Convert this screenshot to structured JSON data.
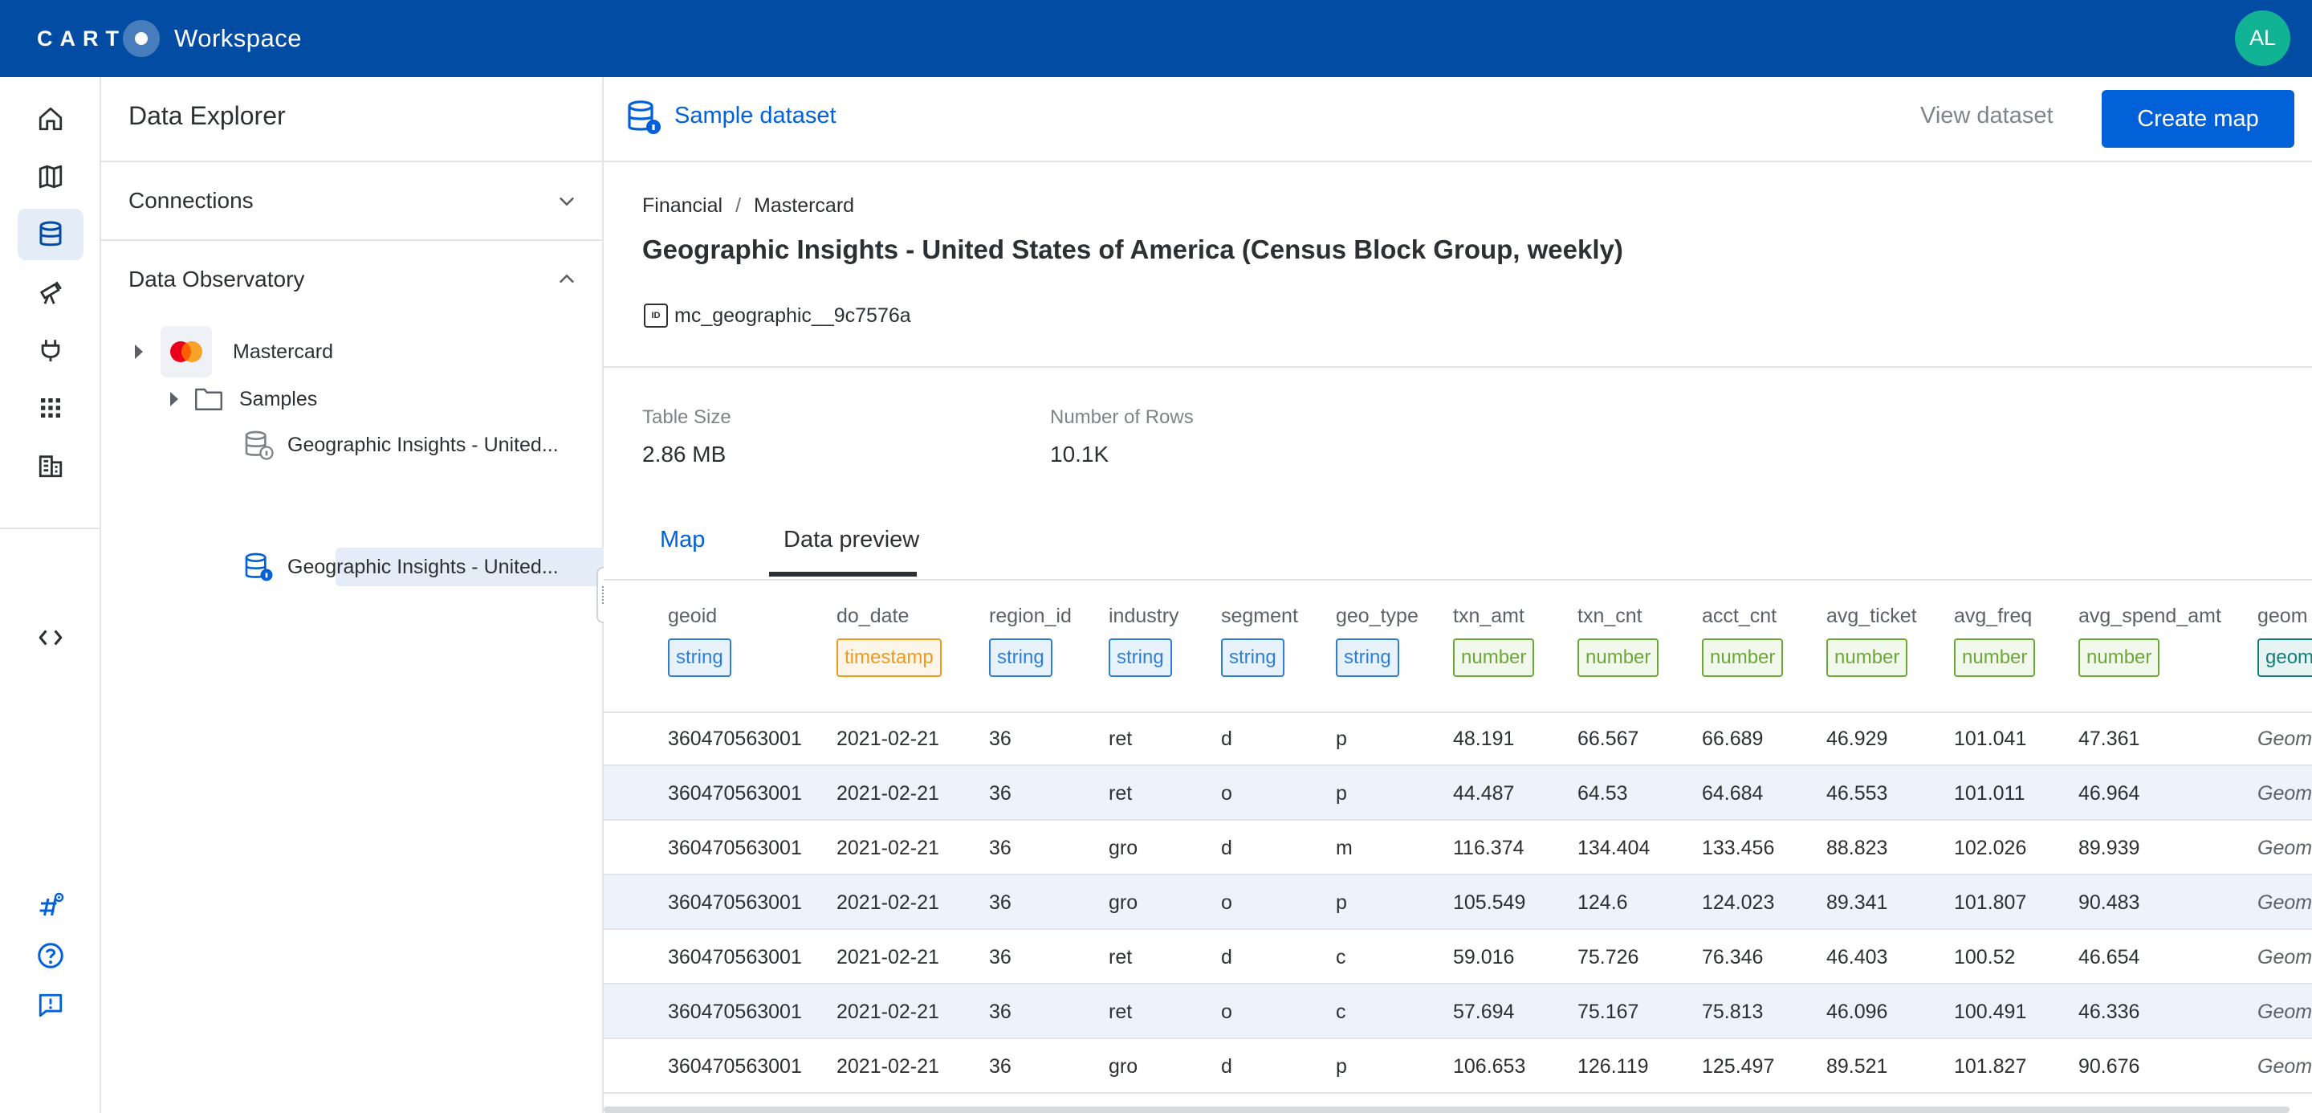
{
  "topbar": {
    "logo_text": "CARTO",
    "product": "Workspace",
    "avatar_initials": "AL"
  },
  "rail": {
    "items": [
      "home-icon",
      "map-icon",
      "database-icon",
      "telescope-icon",
      "plug-icon",
      "apps-grid-icon",
      "building-icon"
    ],
    "active": "database-icon",
    "bottom_items": [
      "developers-code-icon",
      "hashtag-icon",
      "help-icon",
      "feedback-icon"
    ]
  },
  "explorer": {
    "title": "Data Explorer",
    "connections_label": "Connections",
    "observatory_label": "Data Observatory",
    "provider": "Mastercard",
    "folder": "Samples",
    "datasets": [
      "Geographic Insights - United...",
      "Geographic Insights - United..."
    ]
  },
  "header": {
    "dataset_label": "Sample dataset",
    "view_dataset": "View dataset",
    "create_map": "Create map"
  },
  "dataset": {
    "breadcrumb": [
      "Financial",
      "Mastercard"
    ],
    "breadcrumb_sep": "/",
    "title": "Geographic Insights - United States of America (Census Block Group, weekly)",
    "id_badge": "ID",
    "id": "mc_geographic__9c7576a",
    "stats": [
      {
        "label": "Table Size",
        "value": "2.86 MB"
      },
      {
        "label": "Number of Rows",
        "value": "10.1K"
      }
    ]
  },
  "tabs": [
    "Map",
    "Data preview"
  ],
  "active_tab": "Data preview",
  "table": {
    "columns": [
      {
        "name": "geoid",
        "type": "string"
      },
      {
        "name": "do_date",
        "type": "timestamp"
      },
      {
        "name": "region_id",
        "type": "string"
      },
      {
        "name": "industry",
        "type": "string"
      },
      {
        "name": "segment",
        "type": "string"
      },
      {
        "name": "geo_type",
        "type": "string"
      },
      {
        "name": "txn_amt",
        "type": "number"
      },
      {
        "name": "txn_cnt",
        "type": "number"
      },
      {
        "name": "acct_cnt",
        "type": "number"
      },
      {
        "name": "avg_ticket",
        "type": "number"
      },
      {
        "name": "avg_freq",
        "type": "number"
      },
      {
        "name": "avg_spend_amt",
        "type": "number"
      },
      {
        "name": "geom",
        "type": "geom"
      }
    ],
    "rows": [
      [
        "360470563001",
        "2021-02-21",
        "36",
        "ret",
        "d",
        "p",
        "48.191",
        "66.567",
        "66.689",
        "46.929",
        "101.041",
        "47.361",
        "Geom"
      ],
      [
        "360470563001",
        "2021-02-21",
        "36",
        "ret",
        "o",
        "p",
        "44.487",
        "64.53",
        "64.684",
        "46.553",
        "101.011",
        "46.964",
        "Geom"
      ],
      [
        "360470563001",
        "2021-02-21",
        "36",
        "gro",
        "d",
        "m",
        "116.374",
        "134.404",
        "133.456",
        "88.823",
        "102.026",
        "89.939",
        "Geom"
      ],
      [
        "360470563001",
        "2021-02-21",
        "36",
        "gro",
        "o",
        "p",
        "105.549",
        "124.6",
        "124.023",
        "89.341",
        "101.807",
        "90.483",
        "Geom"
      ],
      [
        "360470563001",
        "2021-02-21",
        "36",
        "ret",
        "d",
        "c",
        "59.016",
        "75.726",
        "76.346",
        "46.403",
        "100.52",
        "46.654",
        "Geom"
      ],
      [
        "360470563001",
        "2021-02-21",
        "36",
        "ret",
        "o",
        "c",
        "57.694",
        "75.167",
        "75.813",
        "46.096",
        "100.491",
        "46.336",
        "Geom"
      ],
      [
        "360470563001",
        "2021-02-21",
        "36",
        "gro",
        "d",
        "p",
        "106.653",
        "126.119",
        "125.497",
        "89.521",
        "101.827",
        "90.676",
        "Geom"
      ]
    ]
  },
  "colors": {
    "topbar": "#024ca4",
    "primary": "#0260d8",
    "string": "#2d7fd6",
    "timestamp": "#ee9a1f",
    "number": "#6aa838",
    "geom": "#127e78"
  }
}
